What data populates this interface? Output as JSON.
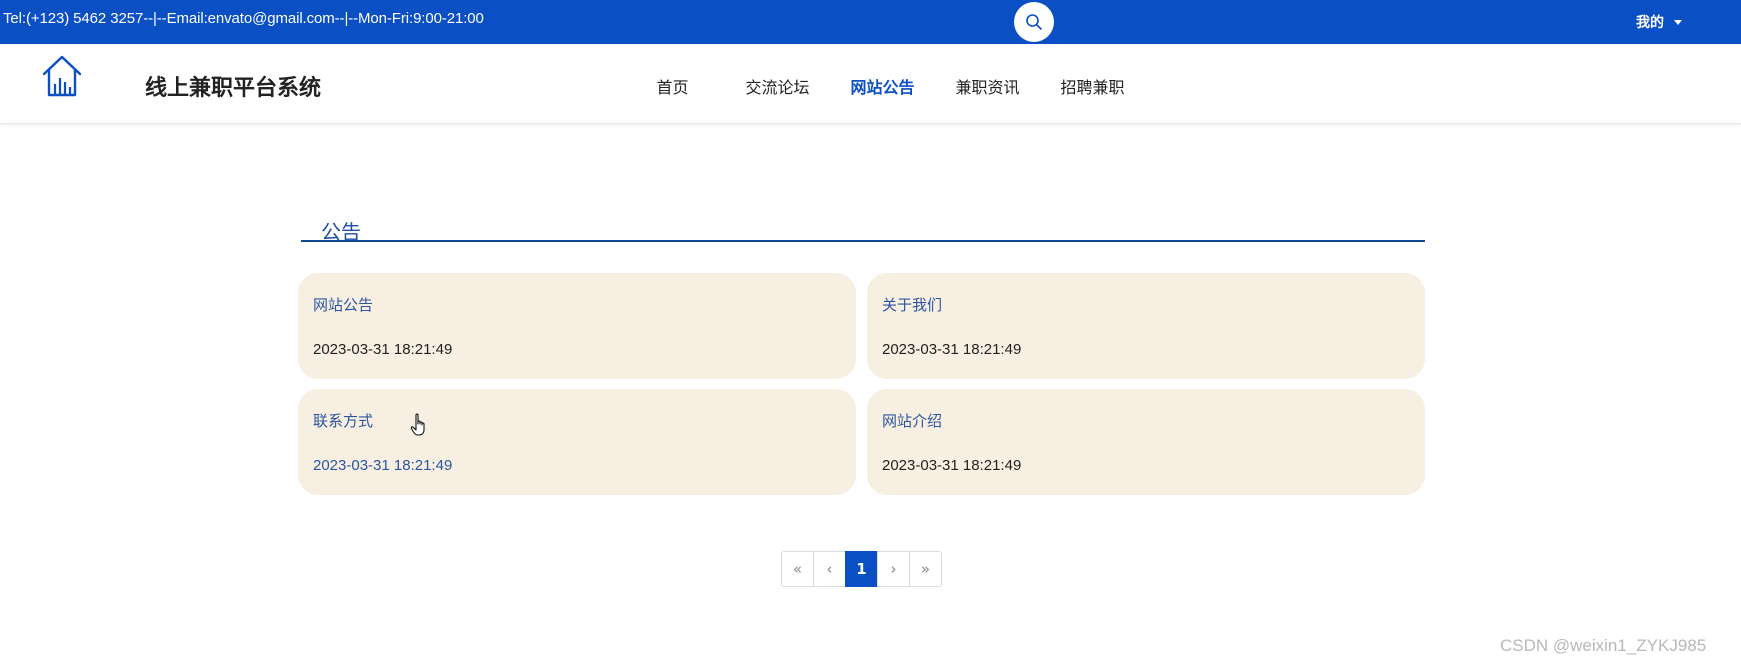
{
  "topbar": {
    "contact": "Tel:(+123) 5462 3257--|--Email:envato@gmail.com--|--Mon-Fri:9:00-21:00",
    "user_menu_label": "我的",
    "background": "#0b4fc4"
  },
  "header": {
    "site_title": "线上兼职平台系统",
    "nav": [
      {
        "label": "首页"
      },
      {
        "label": "交流论坛"
      },
      {
        "label": "网站公告"
      },
      {
        "label": "兼职资讯"
      },
      {
        "label": "招聘兼职"
      }
    ],
    "active_nav": "网站公告"
  },
  "section": {
    "title": "公告"
  },
  "notices": [
    {
      "title": "网站公告",
      "date": "2023-03-31 18:21:49"
    },
    {
      "title": "关于我们",
      "date": "2023-03-31 18:21:49"
    },
    {
      "title": "联系方式",
      "date": "2023-03-31 18:21:49"
    },
    {
      "title": "网站介绍",
      "date": "2023-03-31 18:21:49"
    }
  ],
  "pagination": {
    "first": "«",
    "prev": "‹",
    "current": "1",
    "next": "›",
    "last": "»"
  },
  "watermark": "CSDN @weixin1_ZYKJ985",
  "icons": {
    "search": "search-icon",
    "logo": "house-chart-icon",
    "caret": "caret-down-icon",
    "cursor": "hand-pointer-icon"
  },
  "colors": {
    "primary": "#0b4fc4",
    "card_bg": "#f7f0e2",
    "link": "#2c55a0"
  }
}
